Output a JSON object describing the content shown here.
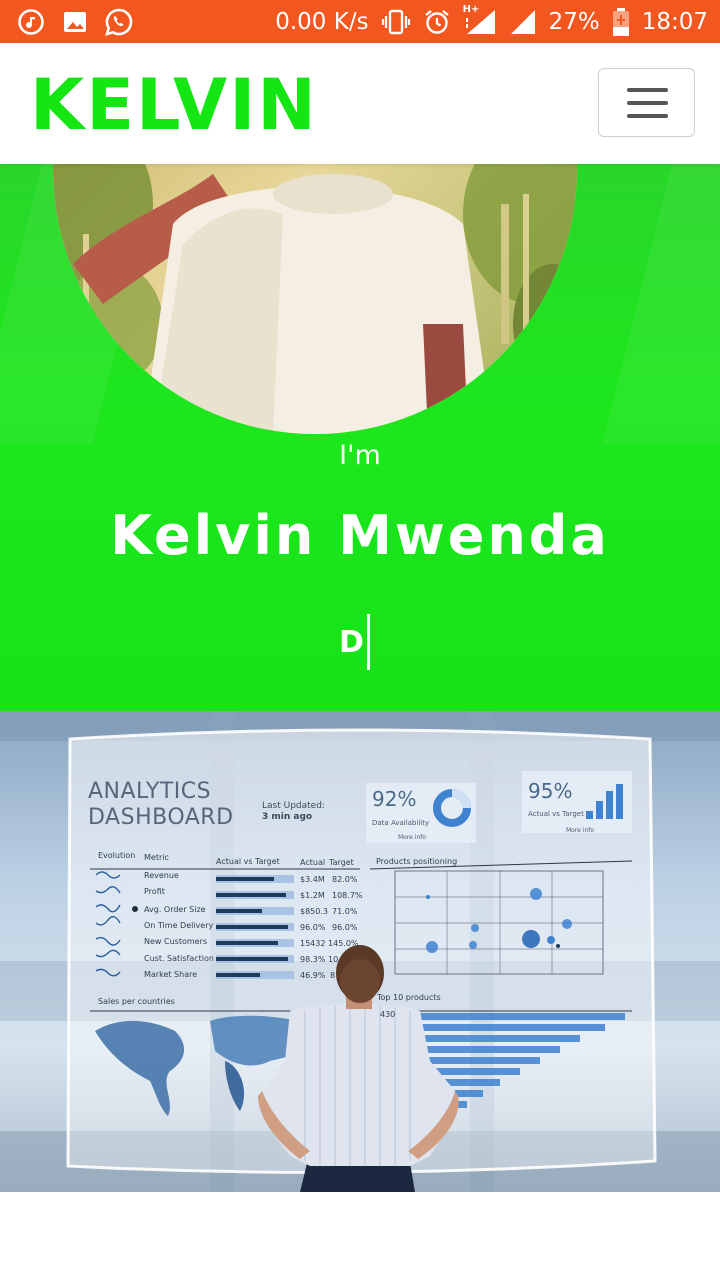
{
  "status_bar": {
    "net_speed": "0.00 K/s",
    "battery": "27%",
    "time": "18:07",
    "network_type": "H+",
    "icons": [
      "music-app-icon",
      "gallery-icon",
      "whatsapp-icon",
      "vibrate-icon",
      "alarm-icon",
      "signal-icon",
      "battery-icon"
    ]
  },
  "navbar": {
    "brand": "KELVIN",
    "brand_color": "#14e614",
    "menu_icon": "hamburger-icon"
  },
  "hero": {
    "intro": "I'm",
    "name": "Kelvin Mwenda",
    "typed_text": "D",
    "background_color": "#16e416"
  },
  "dashboard_image": {
    "title_line1": "ANALYTICS",
    "title_line2": "DASHBOARD",
    "last_updated_label": "Last Updated:",
    "last_updated_value": "3 min ago",
    "kpi_availability": {
      "value": "92%",
      "label": "Data Availability",
      "link": "More info"
    },
    "kpi_actual": {
      "value": "95%",
      "label": "Actual vs Target",
      "link": "More info"
    },
    "table_headers": [
      "Evolution",
      "Metric",
      "Actual vs Target",
      "Actual",
      "Target"
    ],
    "table_rows": [
      {
        "metric": "Revenue",
        "actual": "$3.4M",
        "target": "82.0%"
      },
      {
        "metric": "Profit",
        "actual": "$1.2M",
        "target": "108.7%"
      },
      {
        "metric": "Avg. Order Size",
        "actual": "$850.3",
        "target": "71.0%"
      },
      {
        "metric": "On Time Delivery",
        "actual": "96.0%",
        "target": "96.0%"
      },
      {
        "metric": "New Customers",
        "actual": "15432",
        "target": "145.0%"
      },
      {
        "metric": "Cust. Satisfaction",
        "actual": "98.3%",
        "target": "10"
      },
      {
        "metric": "Market Share",
        "actual": "46.9%",
        "target": "8"
      }
    ],
    "products_positioning": "Products positioning",
    "sales_per_countries": "Sales per countries",
    "top_products": "Top 10 products",
    "top_products_first": "430"
  }
}
